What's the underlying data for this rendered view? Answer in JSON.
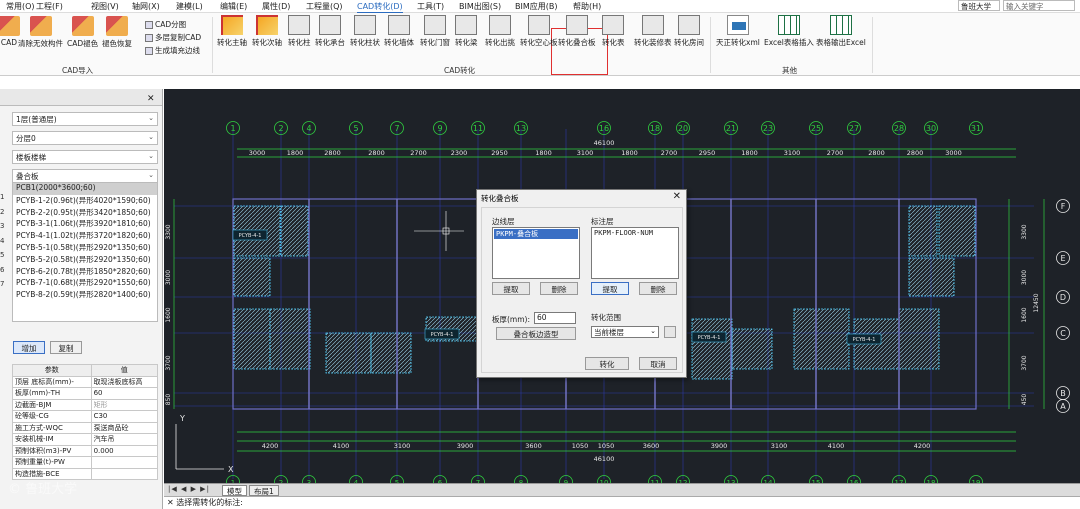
{
  "menu": {
    "items": [
      "常用(O)",
      "工程(F)",
      "视图(V)",
      "轴网(X)",
      "建模(L)",
      "编辑(E)",
      "属性(D)",
      "工程量(Q)",
      "CAD转化(D)",
      "工具(T)",
      "BIM出图(S)",
      "BIM应用(B)",
      "帮助(H)"
    ],
    "active_index": 8,
    "user": "鲁班大学",
    "search_placeholder": "输入关键字"
  },
  "ribbon": {
    "cad_import": {
      "buttons": [
        "CAD",
        "清除无效构件",
        "CAD褪色",
        "褪色恢复"
      ],
      "small_buttons": [
        "CAD分图",
        "多层复制CAD",
        "生成填充边线"
      ],
      "label": "CAD导入"
    },
    "cad_convert": {
      "buttons": [
        "转化主轴",
        "转化次轴",
        "转化柱",
        "转化承台",
        "转化柱状",
        "转化墙体",
        "转化门窗",
        "转化梁",
        "转化出挑",
        "转化空心板",
        "转化叠合板",
        "转化表",
        "转化装修表",
        "转化房间"
      ],
      "label": "CAD转化",
      "highlighted": "转化叠合板"
    },
    "other": {
      "buttons": [
        "天正转化xml",
        "Excel表格插入",
        "表格输出Excel"
      ],
      "label": "其他"
    }
  },
  "left_panel": {
    "dropdowns": [
      "1层(普通层)",
      "分层0",
      "楼板楼梯",
      "叠合板"
    ],
    "list_header": "PCB1(2000*3600;60)",
    "list_items": [
      "PCYB-1-2(0.96t)(异形4020*1590;60)",
      "PCYB-2-2(0.95t)(异形3420*1850;60)",
      "PCYB-3-1(1.06t)(异形3920*1810;60)",
      "PCYB-4-1(1.02t)(异形3720*1820;60)",
      "PCYB-5-1(0.58t)(异形2920*1350;60)",
      "PCYB-5-2(0.58t)(异形2920*1350;60)",
      "PCYB-6-2(0.78t)(异形1850*2820;60)",
      "PCYB-7-1(0.68t)(异形2920*1550;60)",
      "PCYB-8-2(0.59t)(异形2820*1400;60)"
    ],
    "add_button": "增加",
    "copy_button": "复制",
    "prop_headers": [
      "参数",
      "值"
    ],
    "props": [
      [
        "顶层 底标高(mm)-",
        "取现浇板底标高"
      ],
      [
        "板厚(mm)-TH",
        "60"
      ],
      [
        "边截面-BJM",
        "矩形"
      ],
      [
        "砼等级-CG",
        "C30"
      ],
      [
        "施工方式-WQC",
        "泵送商品砼"
      ],
      [
        "安装机械-IM",
        "汽车吊"
      ],
      [
        "预制体积(m3)-PV",
        "0.000"
      ],
      [
        "预制重量(t)-PW",
        ""
      ],
      [
        "构造措施-BCE",
        ""
      ]
    ],
    "row_markers": [
      "1",
      "2",
      "3",
      "4",
      "5",
      "6",
      "7"
    ]
  },
  "cad": {
    "top_axes": [
      "1",
      "2",
      "4",
      "5",
      "7",
      "9",
      "11",
      "13",
      "16",
      "18",
      "20",
      "21",
      "23",
      "25",
      "27",
      "28",
      "30",
      "31"
    ],
    "bottom_axes": [
      "1",
      "2",
      "3",
      "4",
      "5",
      "6",
      "7",
      "8",
      "9",
      "10",
      "11",
      "12",
      "13",
      "14",
      "15",
      "16",
      "17",
      "18",
      "19",
      "20",
      "21",
      "22",
      "23",
      "24",
      "25",
      "26",
      "27",
      "28",
      "29",
      "30",
      "31"
    ],
    "top_dims": [
      "3000",
      "1800",
      "2800",
      "2800",
      "2700",
      "2300",
      "2950",
      "1800",
      "3100",
      "1800",
      "2700",
      "2950",
      "1800",
      "3100",
      "2700",
      "2800",
      "2800",
      "3000"
    ],
    "bottom_dims": [
      "4200",
      "4100",
      "3100",
      "3900",
      "3600",
      "1050",
      "1050",
      "3600",
      "3900",
      "3100",
      "4100",
      "4200"
    ],
    "total_dim": "46100",
    "right_axes": [
      "F",
      "E",
      "D",
      "C",
      "B",
      "A"
    ],
    "right_dims": [
      "3300",
      "3000",
      "1600",
      "3700",
      "450"
    ],
    "right_total": "12450",
    "left_dims": [
      "3300",
      "3000",
      "1600",
      "3700",
      "850"
    ],
    "panel_label": "PCYB-4-1",
    "axis_x": "X",
    "axis_y": "Y"
  },
  "tabs": [
    "布局1"
  ],
  "active_tab": "模型",
  "command": "选择需转化的标注:",
  "dialog": {
    "title": "转化叠合板",
    "edge_layer_label": "边线层",
    "edge_layer_item": "PKPM-叠合板",
    "note_layer_label": "标注层",
    "note_layer_item": "PKPM-FLOOR-NUM",
    "pick": "提取",
    "delete": "删除",
    "thickness_label": "板厚(mm):",
    "thickness": "60",
    "edge_shape_btn": "叠合板边造型",
    "range_label": "转化范围",
    "range_value": "当前楼层",
    "convert": "转化",
    "cancel": "取消"
  },
  "watermark": "鲁班大学"
}
